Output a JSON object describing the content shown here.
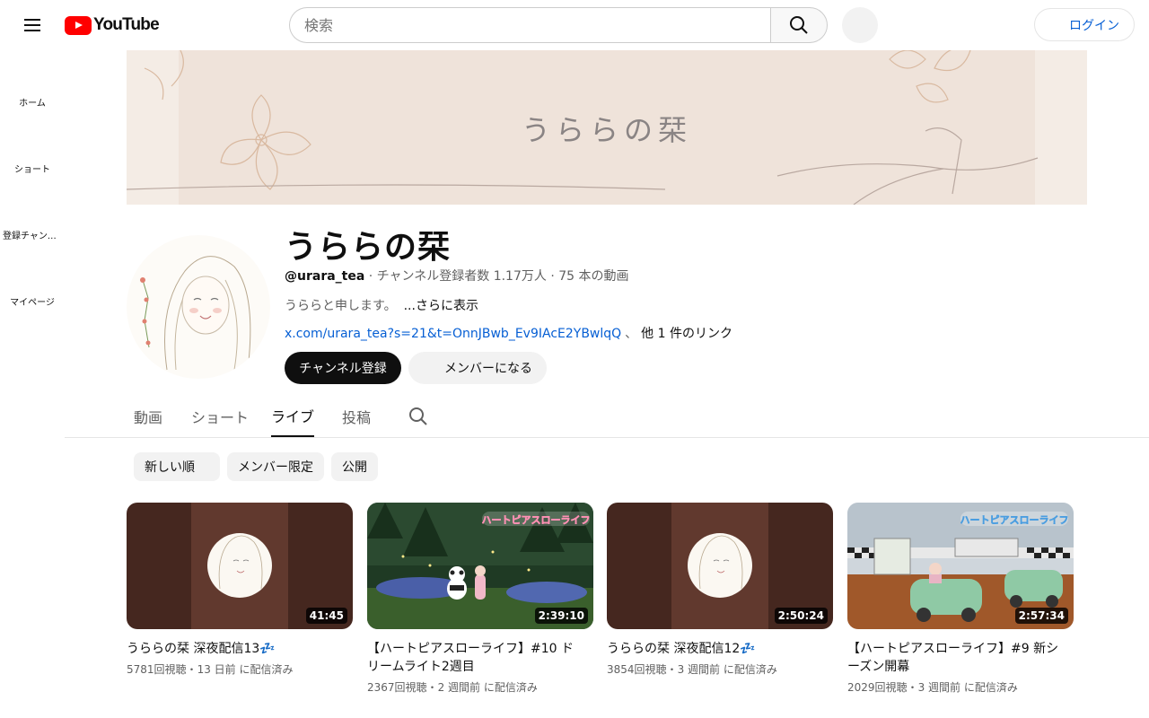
{
  "header": {
    "logo_text": "YouTube",
    "search_placeholder": "検索",
    "login_label": "ログイン"
  },
  "sidebar": {
    "items": [
      {
        "label": "ホーム",
        "icon": "home-icon"
      },
      {
        "label": "ショート",
        "icon": "shorts-icon"
      },
      {
        "label": "登録チャンネル",
        "icon": "subscriptions-icon"
      },
      {
        "label": "マイページ",
        "icon": "you-icon"
      }
    ]
  },
  "banner": {
    "title": "うららの栞"
  },
  "channel": {
    "name": "うららの栞",
    "handle": "@urara_tea",
    "subscribers": "チャンネル登録者数 1.17万人",
    "video_count": "75 本の動画",
    "description": "うららと申します。",
    "more_label": "...さらに表示",
    "link": "x.com/urara_tea?s=21&t=OnnJBwb_Ev9IAcE2YBwlqQ",
    "other_links": "他 1 件のリンク",
    "subscribe_label": "チャンネル登録",
    "member_label": "メンバーになる"
  },
  "tabs": [
    {
      "label": "動画",
      "active": false
    },
    {
      "label": "ショート",
      "active": false
    },
    {
      "label": "ライブ",
      "active": true
    },
    {
      "label": "投稿",
      "active": false
    }
  ],
  "chips": [
    {
      "label": "新しい順"
    },
    {
      "label": "メンバー限定"
    },
    {
      "label": "公開"
    }
  ],
  "videos": [
    {
      "title": "うららの栞 深夜配信13💤",
      "views": "5781回視聴",
      "age": "13 日前 に配信済み",
      "duration": "41:45",
      "thumb": "avatar"
    },
    {
      "title": "【ハートピアスローライフ】#10 ドリームライト2週目",
      "views": "2367回視聴",
      "age": "2 週間前 に配信済み",
      "duration": "2:39:10",
      "thumb": "game-forest",
      "overlay_title": "ハートピアスローライフ"
    },
    {
      "title": "うららの栞 深夜配信12💤",
      "views": "3854回視聴",
      "age": "3 週間前 に配信済み",
      "duration": "2:50:24",
      "thumb": "avatar"
    },
    {
      "title": "【ハートピアスローライフ】#9 新シーズン開幕",
      "views": "2029回視聴",
      "age": "3 週間前 に配信済み",
      "duration": "2:57:34",
      "thumb": "game-room",
      "overlay_title": "ハートピアスローライフ"
    }
  ],
  "meta_separator": "・",
  "colors": {
    "brand_red": "#ff0000",
    "link_blue": "#065fd4",
    "thumb_brown": "#5c3a30"
  }
}
